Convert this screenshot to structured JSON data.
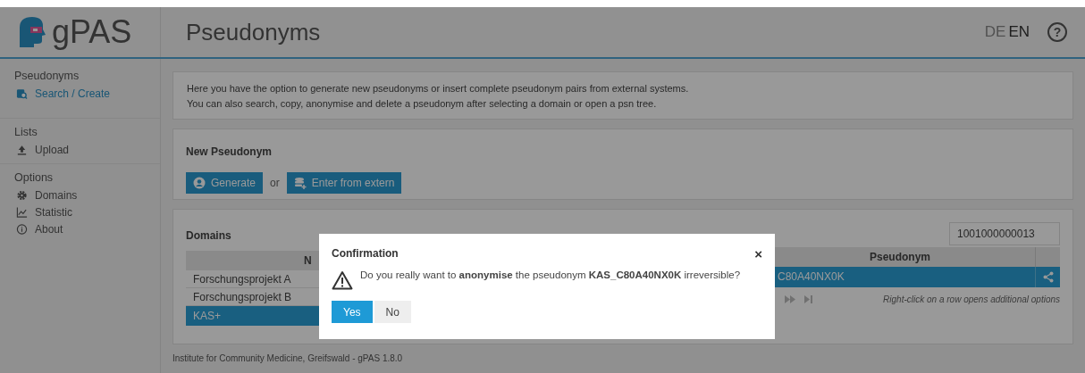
{
  "app": {
    "logo_text": "gPAS"
  },
  "header": {
    "title": "Pseudonyms",
    "languages": [
      {
        "label": "DE",
        "selected": false
      },
      {
        "label": "EN",
        "selected": true
      }
    ],
    "help": "?"
  },
  "sidebar": {
    "sections": [
      {
        "title": "Pseudonyms",
        "items": [
          {
            "label": "Search / Create",
            "kind": "search",
            "selected": true
          }
        ]
      },
      {
        "title": "Lists",
        "items": [
          {
            "label": "Upload",
            "kind": "upload",
            "selected": false
          }
        ]
      },
      {
        "title": "Options",
        "items": [
          {
            "label": "Domains",
            "kind": "gear",
            "selected": false
          },
          {
            "label": "Statistic",
            "kind": "chart",
            "selected": false
          },
          {
            "label": "About",
            "kind": "info",
            "selected": false
          }
        ]
      }
    ]
  },
  "info": {
    "lines": [
      "Here you have the option to generate new pseudonyms or insert complete pseudonym pairs from external systems.",
      "You can also search, copy, anonymise and delete a pseudonym after selecting a domain or open a psn tree."
    ]
  },
  "new_pseudonym": {
    "title": "New Pseudonym",
    "separator": "or",
    "buttons": [
      {
        "label": "Generate",
        "kind": "user"
      },
      {
        "label": "Enter from extern",
        "kind": "database"
      }
    ]
  },
  "domains": {
    "title": "Domains",
    "column_1": "N",
    "rows": [
      {
        "label": "Forschungsprojekt A",
        "selected": false
      },
      {
        "label": "Forschungsprojekt B",
        "selected": false
      },
      {
        "label": "KAS+",
        "selected": true
      }
    ]
  },
  "pseudonyms": {
    "search_value": "1001000000013",
    "column": "Pseudonym",
    "rows": [
      {
        "pseudonym": "C80A40NX0K",
        "selected": true
      }
    ],
    "hint": "Right-click on a row opens additional options"
  },
  "footer": "Institute for Community Medicine, Greifswald - gPAS 1.8.0",
  "dialog": {
    "title": "Confirmation",
    "close": "×",
    "message": "Do you really want to **anonymise** the pseudonym **KAS_C80A40NX0K** irreversible?",
    "buttons": [
      {
        "label": "Yes",
        "kind": "primary"
      },
      {
        "label": "No",
        "kind": "secondary"
      }
    ]
  }
}
